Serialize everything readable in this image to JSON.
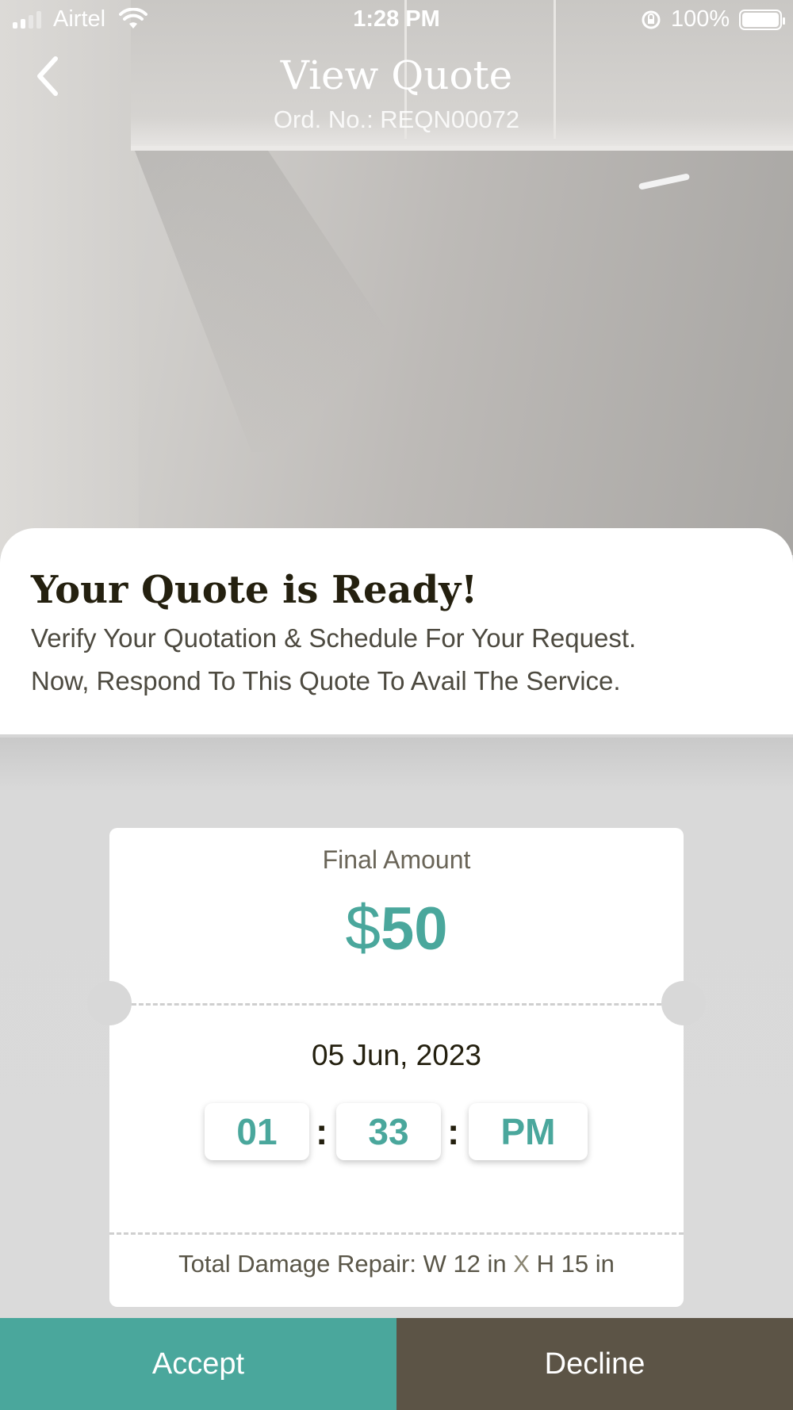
{
  "status_bar": {
    "carrier": "Airtel",
    "time": "1:28 PM",
    "battery": "100%"
  },
  "header": {
    "title": "View Quote",
    "order_number": "Ord. No.: REQN00072",
    "back_icon": "chevron-left-icon"
  },
  "sheet": {
    "title": "Your Quote is Ready!",
    "line1": "Verify Your Quotation & Schedule For Your Request.",
    "line2": "Now, Respond To This Quote To Avail The Service."
  },
  "quote": {
    "amount_label": "Final Amount",
    "currency": "$",
    "amount": "50",
    "date": "05 Jun, 2023",
    "time_hour": "01",
    "time_minute": "33",
    "time_ampm": "PM",
    "colon": ":",
    "repair_prefix": "Total Damage Repair: W 12 in",
    "repair_x": "X",
    "repair_suffix": "H 15 in"
  },
  "actions": {
    "accept_label": "Accept",
    "decline_label": "Decline"
  },
  "colors": {
    "accent": "#4aa79c",
    "decline": "#5c5446",
    "heading": "#24200f"
  }
}
